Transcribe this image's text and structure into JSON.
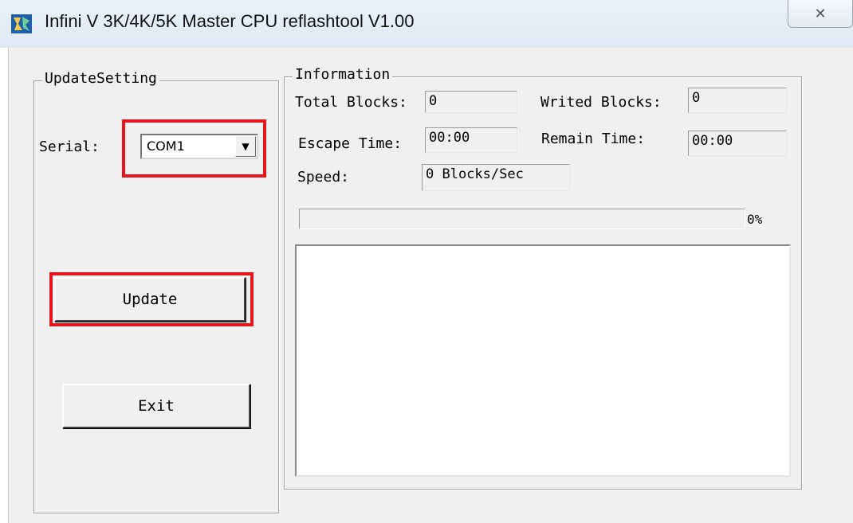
{
  "window": {
    "title": "Infini V 3K/4K/5K Master CPU reflashtool V1.00",
    "app_icon": "app-icon",
    "close_symbol": "✕"
  },
  "update_setting": {
    "title": "UpdateSetting",
    "serial_label": "Serial:",
    "serial_value": "COM1",
    "dropdown_arrow": "▼",
    "update_label": "Update",
    "exit_label": "Exit"
  },
  "information": {
    "title": "Information",
    "total_blocks_label": "Total Blocks:",
    "total_blocks_value": "0",
    "writed_blocks_label": "Writed Blocks:",
    "writed_blocks_value": "0",
    "escape_time_label": "Escape Time:",
    "escape_time_value": "00:00",
    "remain_time_label": "Remain Time:",
    "remain_time_value": "00:00",
    "speed_label": "Speed:",
    "speed_value": "0 Blocks/Sec",
    "progress_percent": 0,
    "progress_text": "0%"
  },
  "log": {
    "text": ""
  },
  "colors": {
    "highlight": "#e8141b",
    "face": "#f0f0f0"
  }
}
